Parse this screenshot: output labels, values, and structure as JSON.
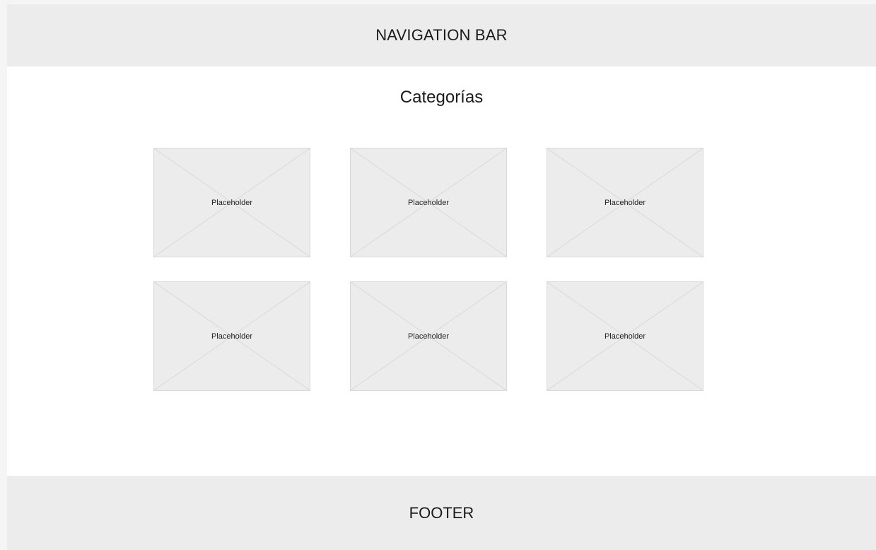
{
  "navbar": {
    "label": "NAVIGATION BAR"
  },
  "main": {
    "title": "Categorías",
    "cards": [
      {
        "label": "Placeholder"
      },
      {
        "label": "Placeholder"
      },
      {
        "label": "Placeholder"
      },
      {
        "label": "Placeholder"
      },
      {
        "label": "Placeholder"
      },
      {
        "label": "Placeholder"
      }
    ]
  },
  "footer": {
    "label": "FOOTER"
  },
  "colors": {
    "band": "#ececec",
    "background": "#ffffff",
    "placeholder_fill": "#ececec",
    "placeholder_stroke": "#d8d8d8"
  }
}
